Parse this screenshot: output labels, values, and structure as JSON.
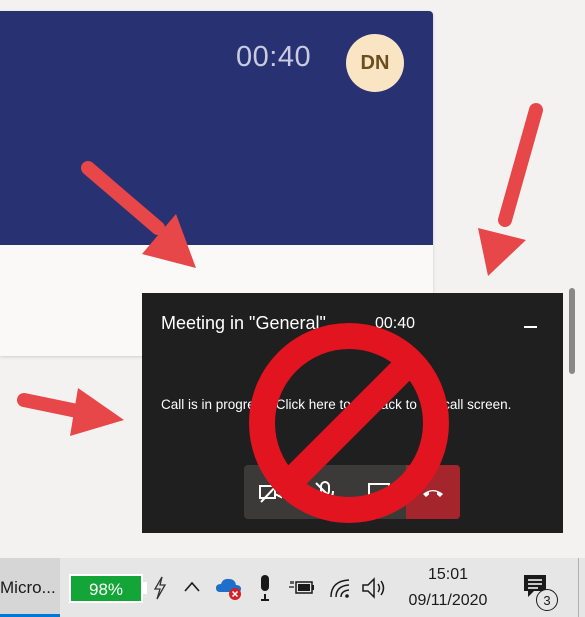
{
  "card": {
    "timer": "00:40",
    "avatar_initials": "DN"
  },
  "mini_window": {
    "title": "Meeting in \"General\"",
    "timer": "00:40",
    "message": "Call is in progress. Click here to go back to the call screen.",
    "controls": [
      "camera-off-icon",
      "mic-off-icon",
      "share-screen-icon",
      "hang-up-icon"
    ]
  },
  "taskbar": {
    "app_label": "Micro...",
    "battery_percent": "98%",
    "clock_time": "15:01",
    "clock_date": "09/11/2020",
    "notification_count": "3"
  },
  "colors": {
    "header": "#283272",
    "mini_window": "#1f1f1f",
    "hangup": "#a4262c",
    "arrow": "#e8474a",
    "no_sign": "#e2141f",
    "battery": "#13a537"
  }
}
